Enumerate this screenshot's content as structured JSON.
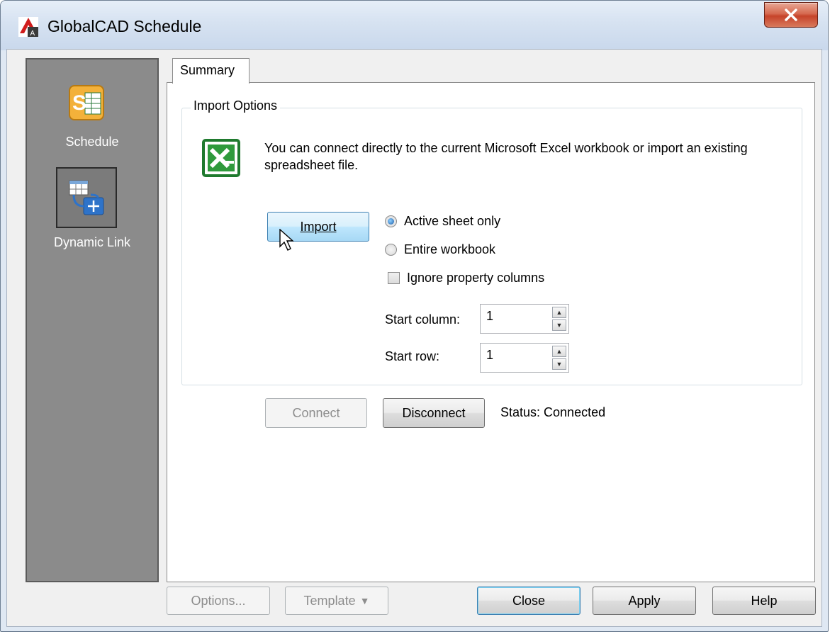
{
  "window": {
    "title": "GlobalCAD Schedule"
  },
  "nav": {
    "items": [
      {
        "label": "Schedule",
        "icon": "schedule-icon",
        "selected": false
      },
      {
        "label": "Dynamic Link",
        "icon": "dynamic-link-icon",
        "selected": true
      }
    ]
  },
  "tab": {
    "label": "Summary"
  },
  "import_options": {
    "group_label": "Import Options",
    "description": "You can connect directly to the current Microsoft Excel workbook or import an existing spreadsheet file.",
    "import_button": "Import",
    "radio_active_sheet": "Active sheet only",
    "radio_entire_workbook": "Entire workbook",
    "selected_radio": "Active sheet only",
    "checkbox_ignore_columns": "Ignore property columns",
    "checkbox_checked": false,
    "start_column_label": "Start column:",
    "start_column_value": "1",
    "start_row_label": "Start row:",
    "start_row_value": "1"
  },
  "connection": {
    "connect_button": "Connect",
    "disconnect_button": "Disconnect",
    "status": "Status: Connected"
  },
  "footer": {
    "options_button": "Options...",
    "template_button": "Template",
    "close_button": "Close",
    "apply_button": "Apply",
    "help_button": "Help"
  },
  "colors": {
    "nav_background": "#8b8b8b",
    "title_bar": "#d6e2f1",
    "close_button_red": "#c6432a",
    "accent_blue": "#3c7fb1"
  }
}
